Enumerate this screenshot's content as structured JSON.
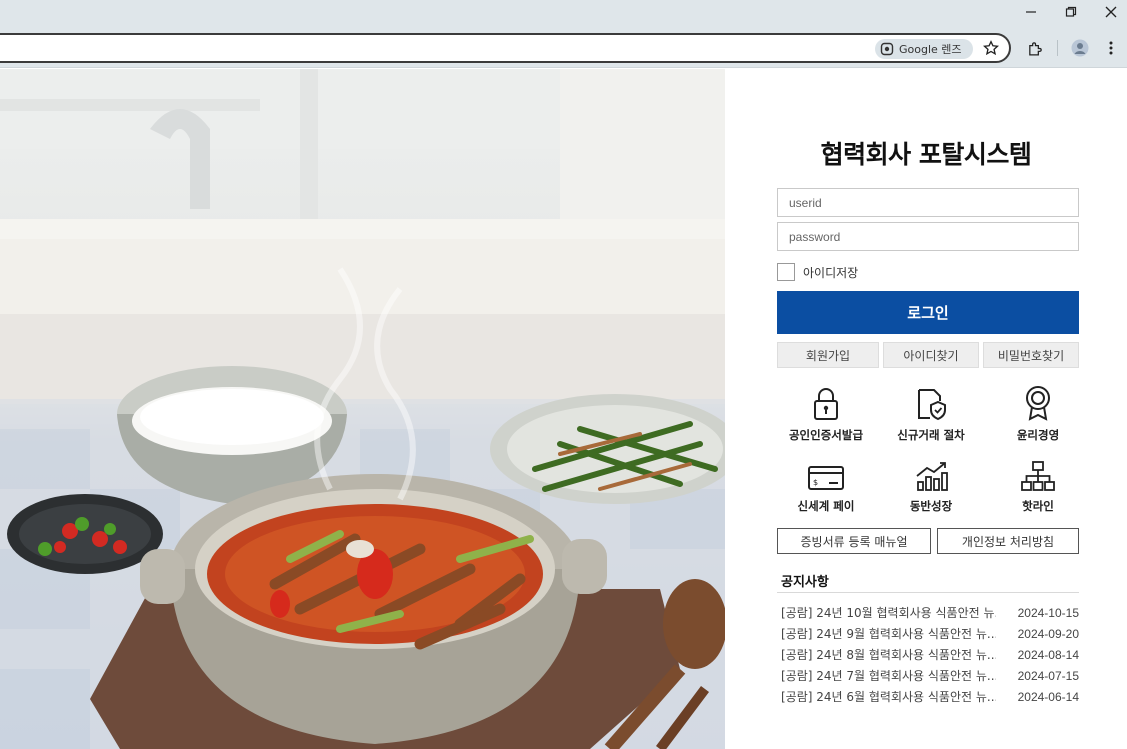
{
  "browser": {
    "lens_label": "Google 렌즈",
    "window_controls": [
      "minimize-icon",
      "restore-icon",
      "close-icon"
    ],
    "toolbar_icons": [
      "google-lens-icon",
      "bookmark-star-icon",
      "extensions-icon",
      "profile-avatar-icon",
      "menu-kebab-icon"
    ]
  },
  "login": {
    "title": "협력회사 포탈시스템",
    "userid_placeholder": "userid",
    "password_placeholder": "password",
    "remember_label": "아이디저장",
    "login_label": "로그인"
  },
  "links": [
    {
      "label": "회원가입"
    },
    {
      "label": "아이디찾기"
    },
    {
      "label": "비밀번호찾기"
    }
  ],
  "services": [
    {
      "label": "공인인증서발급",
      "icon": "lock-icon"
    },
    {
      "label": "신규거래 절차",
      "icon": "document-shield-icon"
    },
    {
      "label": "윤리경영",
      "icon": "award-badge-icon"
    },
    {
      "label": "신세계 페이",
      "icon": "payment-card-icon"
    },
    {
      "label": "동반성장",
      "icon": "growth-chart-icon"
    },
    {
      "label": "핫라인",
      "icon": "org-chart-icon"
    }
  ],
  "manual_buttons": [
    {
      "label": "증빙서류 등록 매뉴얼"
    },
    {
      "label": "개인정보 처리방침"
    }
  ],
  "notices": {
    "title": "공지사항",
    "items": [
      {
        "title": "[공람] 24년 10월 협력회사용 식품안전 뉴...",
        "date": "2024-10-15"
      },
      {
        "title": "[공람] 24년 9월 협력회사용 식품안전 뉴...",
        "date": "2024-09-20"
      },
      {
        "title": "[공람] 24년 8월 협력회사용 식품안전 뉴...",
        "date": "2024-08-14"
      },
      {
        "title": "[공람] 24년 7월 협력회사용 식품안전 뉴...",
        "date": "2024-07-15"
      },
      {
        "title": "[공람] 24년 6월 협력회사용 식품안전 뉴...",
        "date": "2024-06-14"
      }
    ]
  },
  "colors": {
    "primary": "#0b4ea2",
    "chrome": "#dfe6ea"
  }
}
